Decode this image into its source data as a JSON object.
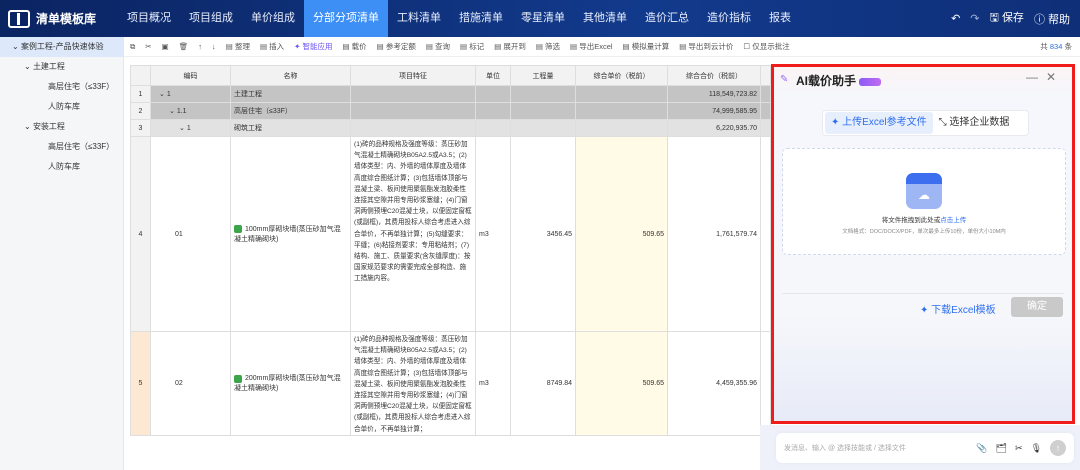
{
  "header": {
    "app_title": "清单模板库",
    "tabs": [
      "项目概况",
      "项目组成",
      "单价组成",
      "分部分项清单",
      "工料清单",
      "措施清单",
      "零星清单",
      "其他清单",
      "造价汇总",
      "造价指标",
      "报表"
    ],
    "active_tab": 3,
    "save": "保存",
    "help": "帮助"
  },
  "toolbar": {
    "items": [
      "整理",
      "插入",
      "智能应用",
      "载价",
      "参考定额",
      "查询",
      "标记",
      "展开到",
      "筛选",
      "导出Excel",
      "模拟量计算",
      "导出到云计价",
      "仅显示批注"
    ],
    "count_prefix": "共",
    "count": "834",
    "count_suffix": "条"
  },
  "sidebar": {
    "items": [
      "案例工程-产品快速体验",
      "土建工程",
      "高层住宅（≤33F）",
      "人防车库",
      "安装工程",
      "高层住宅（≤33F）",
      "人防车库"
    ]
  },
  "table": {
    "headers": [
      "编码",
      "名称",
      "项目特征",
      "单位",
      "工程量",
      "综合单价（税前）",
      "综合合价（税前）"
    ],
    "rows": [
      {
        "n": "1",
        "code": "1",
        "name": "土建工程",
        "total": "118,549,723.82"
      },
      {
        "n": "2",
        "code": "1.1",
        "name": "高层住宅（≤33F）",
        "total": "74,999,585.95"
      },
      {
        "n": "3",
        "code": "1",
        "name": "砌筑工程",
        "total": "6,220,935.70"
      },
      {
        "n": "4",
        "code": "01",
        "name": "100mm厚砌块墙(蒸压砂加气混凝土精确砌块)",
        "feature": "(1)砖的品种规格及强度等级：蒸压砂加气混凝土精确砌块B05A2.5或A3.5；(2)墙体类型：内、外墙的墙体厚度及墙体高度综合图纸计算；(3)包括墙体顶部与混凝土梁、板间使用聚氨酯发泡胶柔性连接其空隙并用专用砂浆塞缝；(4)门窗洞两侧预埋C20混凝土块，以便固定窗框(或副框)，其费用投标人综合考虑进入综合单价，不再单独计算；(5)勾缝要求：平缝；(6)粘接剂要求：专用粘结剂；(7)结构、施工、质量要求(含灰缝厚度)：按国家规范要求的需要完成全部构造、施工措施内容。",
        "unit": "m3",
        "qty": "3456.45",
        "price": "509.65",
        "total": "1,761,579.74"
      },
      {
        "n": "5",
        "code": "02",
        "name": "200mm厚砌块墙(蒸压砂加气混凝土精确砌块)",
        "feature": "(1)砖的品种规格及强度等级：蒸压砂加气混凝土精确砌块B05A2.5或A3.5；(2)墙体类型：内、外墙的墙体厚度及墙体高度综合图纸计算；(3)包括墙体顶部与混凝土梁、板间使用聚氨酯发泡胶柔性连接其空隙并用专用砂浆塞缝；(4)门窗洞两侧预埋C20混凝土块，以便固定窗框(或副框)，其费用投标人综合考虑进入综合单价，不再单独计算；",
        "unit": "m3",
        "qty": "8749.84",
        "price": "509.65",
        "total": "4,459,355.96"
      }
    ]
  },
  "panel": {
    "title": "AI载价助手",
    "tab_upload": "上传Excel参考文件",
    "tab_enterprise": "选择企业数据",
    "drop_text": "将文件拖拽到此处或",
    "drop_link": "点击上传",
    "drop_hint": "文档格式：DOC/DOCX/PDF，单次最多上传10份，单份大小10M内",
    "download": "下载Excel模板",
    "confirm": "确定"
  },
  "chat": {
    "placeholder": "发消息、输入 @ 选择技能或 / 选择文件"
  }
}
